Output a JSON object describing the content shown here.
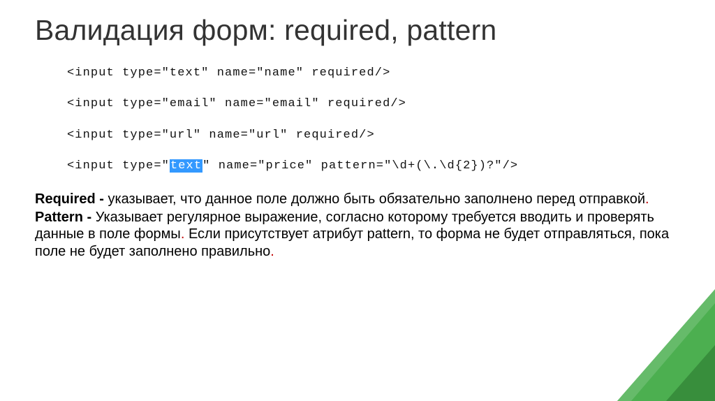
{
  "title": "Валидация форм: required, pattern",
  "code": {
    "l1": "<input type=\"text\" name=\"name\" required/>",
    "l2": "<input type=\"email\" name=\"email\" required/>",
    "l3": "<input type=\"url\" name=\"url\" required/>",
    "l4_pre": "<input type=\"",
    "l4_hl": "text",
    "l4_post": "\" name=\"price\" pattern=\"\\d+(\\.\\d{2})?\"/>"
  },
  "para1": {
    "term": "Required - ",
    "rest": " указывает, что данное поле должно быть обязательно заполнено перед отправкой",
    "stop": "."
  },
  "para2": {
    "term": "Pattern - ",
    "rest1": "Указывает регулярное выражение, согласно которому требуется вводить и проверять данные в поле формы",
    "stop1": ". ",
    "rest2": "Если присутствует атрибут pattern, то форма не будет отправляться, пока поле не будет заполнено правильно",
    "stop2": "."
  }
}
